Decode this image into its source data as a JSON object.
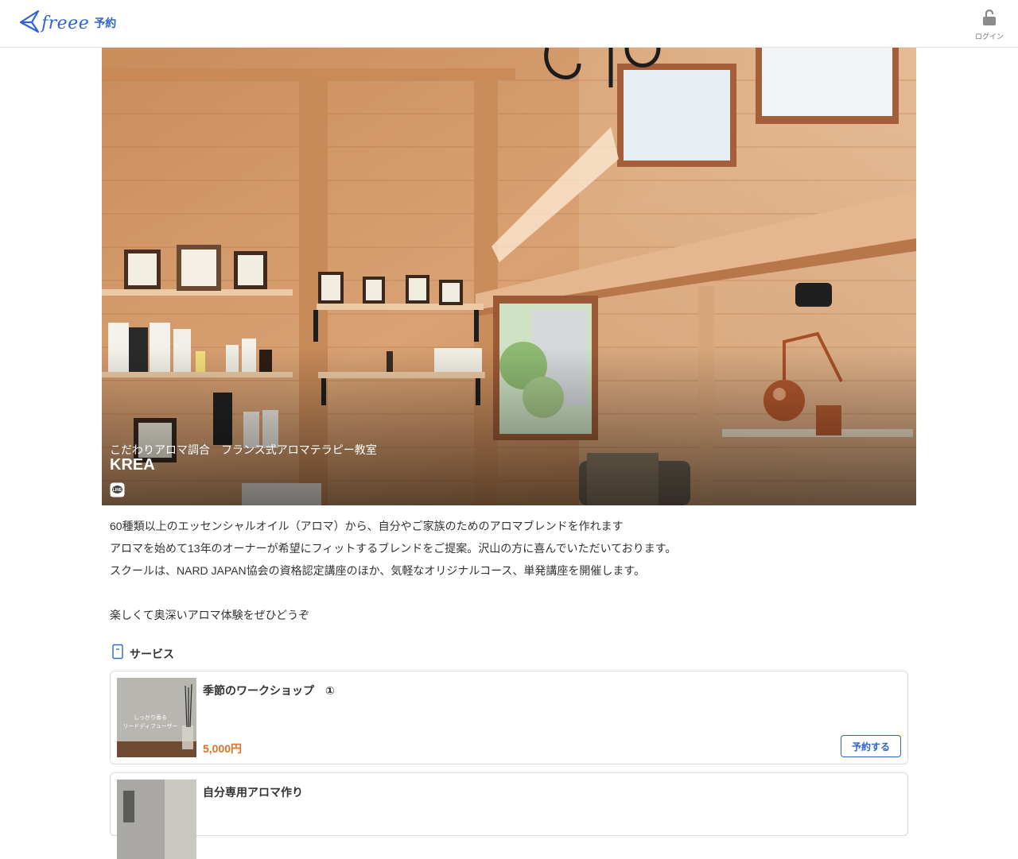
{
  "header": {
    "logo_word": "freee",
    "logo_service": "予約",
    "login_label": "ログイン"
  },
  "hero": {
    "subtitle": "こだわりアロマ調合　フランス式アロマテラピー教室",
    "title": "KREA",
    "social_icons": [
      "home-icon",
      "instagram-icon",
      "line-icon"
    ]
  },
  "description": {
    "lines": [
      "60種類以上のエッセンシャルオイル（アロマ）から、自分やご家族のためのアロマブレンドを作れます",
      "アロマを始めて13年のオーナーが希望にフィットするブレンドをご提案。沢山の方に喜んでいただいております。",
      "スクールは、NARD JAPAN協会の資格認定講座のほか、気軽なオリジナルコース、単発講座を開催します。",
      "",
      "楽しくて奥深いアロマ体験をぜひどうぞ"
    ]
  },
  "services": {
    "heading": "サービス",
    "items": [
      {
        "title": "季節のワークショップ　①",
        "price": "5,000円",
        "button": "予約する",
        "thumb_text": "しっかり香る\nリードディフューザー"
      },
      {
        "title": "自分専用アロマ作り"
      }
    ]
  },
  "colors": {
    "brand": "#2f65d0",
    "price": "#e07024",
    "border": "#d9d9d9"
  }
}
